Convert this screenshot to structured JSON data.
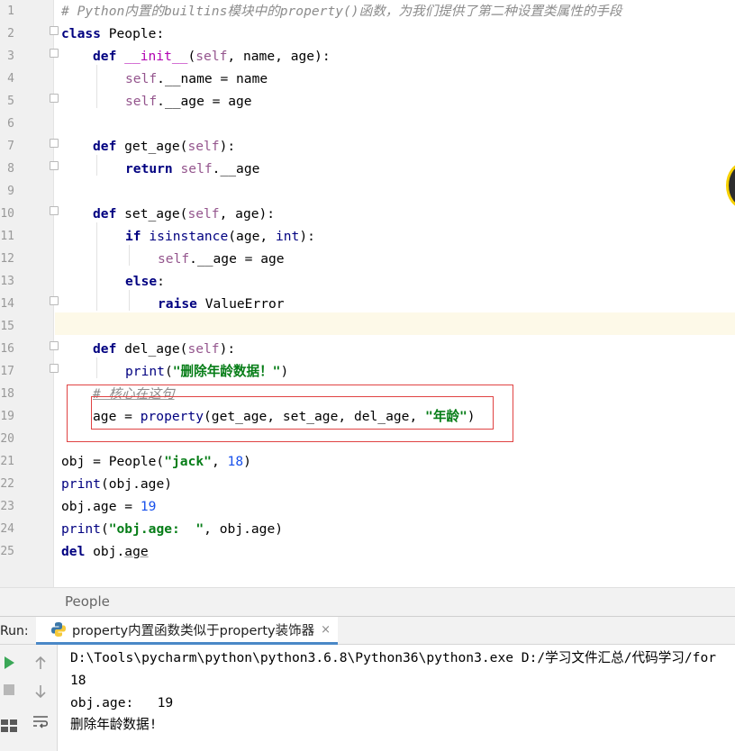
{
  "editor": {
    "line_numbers": [
      "1",
      "2",
      "3",
      "4",
      "5",
      "6",
      "7",
      "8",
      "9",
      "10",
      "11",
      "12",
      "13",
      "14",
      "15",
      "16",
      "17",
      "18",
      "19",
      "20",
      "21",
      "22",
      "23",
      "24",
      "25"
    ],
    "tokens": {
      "l1_comment": "# Python内置的builtins模块中的property()函数，为我们提供了第二种设置类属性的手段",
      "l2_kw": "class",
      "l2_name": " People:",
      "l3_kw": "def",
      "l3_sp": " ",
      "l3_fn": "__init__",
      "l3_p1": "(",
      "l3_self": "self",
      "l3_p2": ", name, age):",
      "l4_self": "self",
      "l4_rest": ".__name = name",
      "l5_self": "self",
      "l5_rest": ".__age = age",
      "l7_kw": "def",
      "l7_fn": " get_age(",
      "l7_self": "self",
      "l7_p": "):",
      "l8_kw": "return",
      "l8_sp": " ",
      "l8_self": "self",
      "l8_rest": ".__age",
      "l10_kw": "def",
      "l10_fn": " set_age(",
      "l10_self": "self",
      "l10_p": ", age):",
      "l11_kw": "if",
      "l11_sp": " ",
      "l11_bi": "isinstance",
      "l11_p1": "(age, ",
      "l11_int": "int",
      "l11_p2": "):",
      "l12_self": "self",
      "l12_rest": ".__age = age",
      "l13_kw": "else",
      "l13_p": ":",
      "l14_kw": "raise",
      "l14_rest": " ValueError",
      "l16_kw": "def",
      "l16_fn": " del_age(",
      "l16_self": "self",
      "l16_p": "):",
      "l17_bi": "print",
      "l17_p1": "(",
      "l17_str": "\"删除年龄数据！\"",
      "l17_p2": ")",
      "l18_comment": "# 核心在这句",
      "l19_a": "age = ",
      "l19_bi": "property",
      "l19_b": "(get_age, set_age, del_age, ",
      "l19_str": "\"年龄\"",
      "l19_c": ")",
      "l21_a": "obj = People(",
      "l21_str": "\"jack\"",
      "l21_b": ", ",
      "l21_num": "18",
      "l21_c": ")",
      "l22_bi": "print",
      "l22_rest": "(obj.age)",
      "l23_a": "obj.age = ",
      "l23_num": "19",
      "l24_bi": "print",
      "l24_p1": "(",
      "l24_str": "\"obj.age:  \"",
      "l24_rest": ", obj.age)",
      "l25_kw": "del",
      "l25_a": " obj.",
      "l25_b": "age"
    }
  },
  "breadcrumb": {
    "item": "People"
  },
  "run_panel": {
    "label": "Run:",
    "tab_title": "property内置函数类似于property装饰器",
    "tab_close": "×",
    "icons": [
      "rerun-icon",
      "stop-icon",
      "up-arrow-icon",
      "down-arrow-icon",
      "layout-icon",
      "soft-wrap-icon",
      "python-icon"
    ],
    "output": [
      "D:\\Tools\\pycharm\\python\\python3.6.8\\Python36\\python3.exe D:/学习文件汇总/代码学习/for",
      "18",
      "obj.age:   19",
      "删除年龄数据!"
    ]
  },
  "colors": {
    "keyword": "#000080",
    "self": "#94558d",
    "string": "#067d17",
    "number": "#1750eb",
    "comment": "#8c8c8c",
    "highlight_box": "#e04343",
    "current_line": "#fdf9e8",
    "run_green": "#3aa757"
  }
}
